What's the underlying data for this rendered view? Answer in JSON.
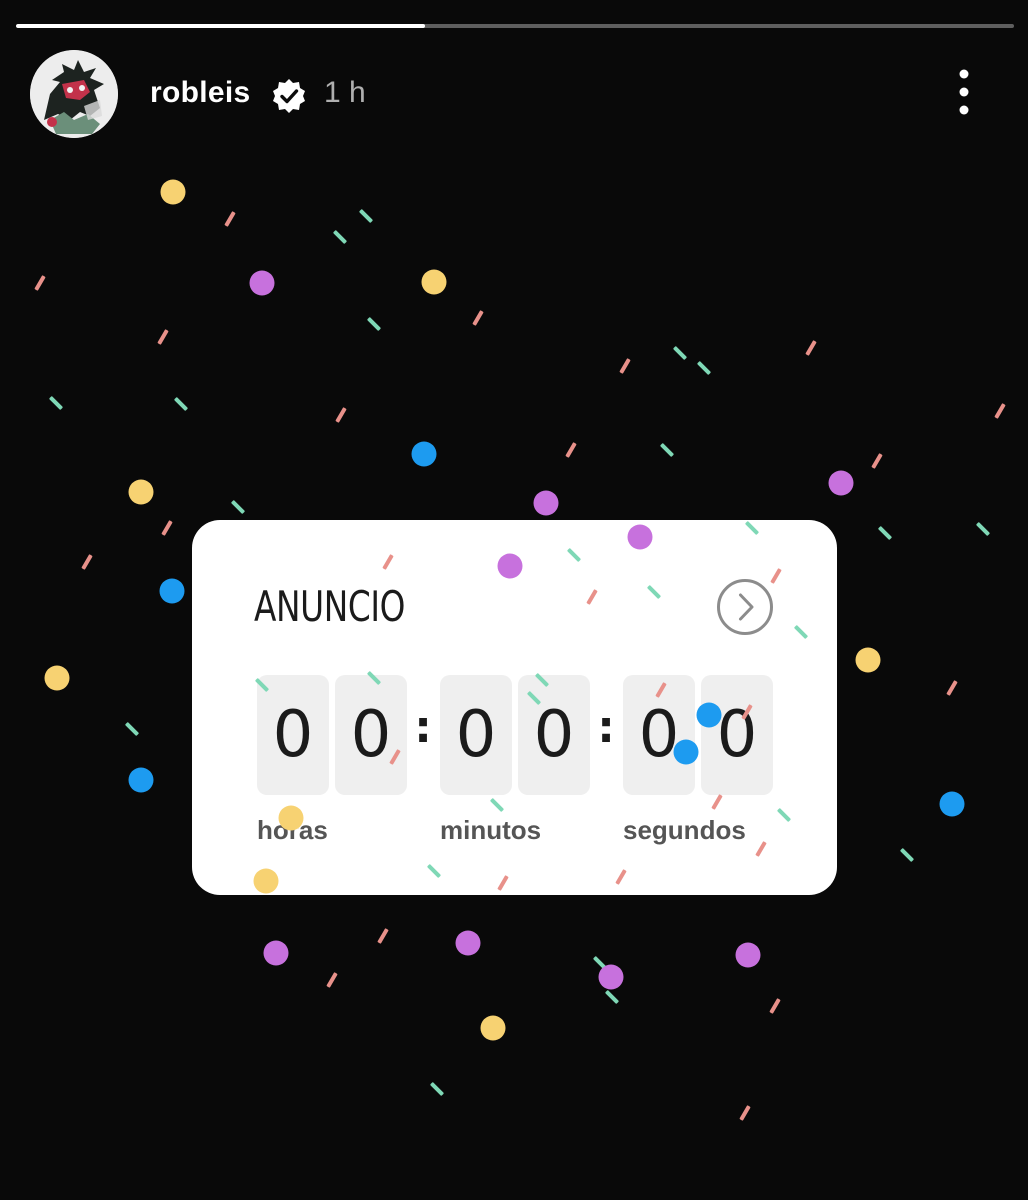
{
  "story": {
    "progress": 0.41,
    "username": "robleis",
    "verified": true,
    "time": "1 h"
  },
  "icons": {
    "verified": "verified-badge-icon",
    "more": "more-options-icon",
    "arrow": "chevron-right-circle-icon"
  },
  "countdown": {
    "title": "ANUNCIO",
    "digits": {
      "hours": [
        "0",
        "0"
      ],
      "minutes": [
        "0",
        "0"
      ],
      "seconds": [
        "0",
        "0"
      ]
    },
    "separator": ":",
    "labels": {
      "hours": "horas",
      "minutes": "minutos",
      "seconds": "segundos"
    }
  },
  "colors": {
    "background": "#090909",
    "confetti_yellow": "#f7d272",
    "confetti_purple": "#c771dd",
    "confetti_blue": "#1d9bf0",
    "confetti_pink": "#e8918a",
    "confetti_mint": "#7fd8b6"
  }
}
